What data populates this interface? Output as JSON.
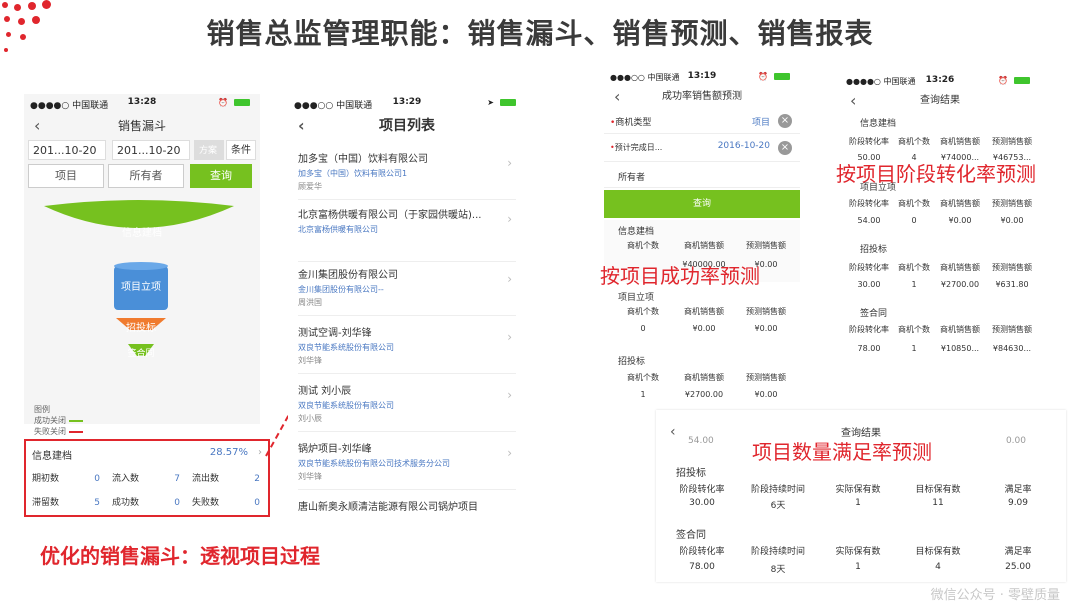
{
  "slide": {
    "title": "销售总监管理职能：销售漏斗、销售预测、销售报表",
    "caption": "优化的销售漏斗：透视项目过程",
    "watermark": "微信公众号 · 零壁质量",
    "colors": {
      "accent": "#e0262d",
      "green": "#76c11f",
      "blue": "#4a78c2"
    }
  },
  "phone1": {
    "status": {
      "carrier": "●●●●○ 中国联通",
      "time": "13:28"
    },
    "nav_title": "销售漏斗",
    "date_from": "201...10-20",
    "date_to": "201...10-20",
    "toggle_a": "方案",
    "toggle_b": "条件",
    "filter_project": "项目",
    "filter_owner": "所有者",
    "query_label": "查询",
    "funnel": [
      "信息建档",
      "项目立项",
      "招投标",
      "签合同"
    ],
    "legend_title": "图例",
    "legend_success": "成功关闭",
    "legend_fail": "失败关闭",
    "stats": {
      "stage": "信息建档",
      "rate": "28.57%",
      "cells": [
        {
          "label": "期初数",
          "value": "0"
        },
        {
          "label": "流入数",
          "value": "7"
        },
        {
          "label": "流出数",
          "value": "2"
        },
        {
          "label": "滞留数",
          "value": "5"
        },
        {
          "label": "成功数",
          "value": "0"
        },
        {
          "label": "失败数",
          "value": "0"
        }
      ]
    }
  },
  "phone2": {
    "status": {
      "carrier": "●●●○○ 中国联通",
      "time": "13:29"
    },
    "nav_title": "项目列表",
    "items": [
      {
        "name": "加多宝（中国）饮料有限公司",
        "company": "加多宝（中国）饮料有限公司1",
        "owner": "顾爱华"
      },
      {
        "name": "北京富杨供暖有限公司（于家园供暖站)...",
        "company": "北京富杨供暖有限公司",
        "owner": ""
      },
      {
        "name": "金川集团股份有限公司",
        "company": "金川集团股份有限公司--",
        "owner": "周洪国"
      },
      {
        "name": "测试空调-刘华锋",
        "company": "双良节能系统股份有限公司",
        "owner": "刘华锋"
      },
      {
        "name": "测试 刘小辰",
        "company": "双良节能系统股份有限公司",
        "owner": "刘小辰"
      },
      {
        "name": "锅炉项目-刘华峰",
        "company": "双良节能系统股份有限公司技术服务分公司",
        "owner": "刘华锋"
      },
      {
        "name": "唐山新奥永顺清洁能源有限公司锅炉项目",
        "company": "",
        "owner": ""
      }
    ]
  },
  "phone3": {
    "status": {
      "carrier": "●●●○○ 中国联通",
      "time": "13:19"
    },
    "nav_title": "成功率销售额预测",
    "field1_label": "商机类型",
    "field1_value": "项目",
    "field2_label": "预计完成日...",
    "field2_value": "2016-10-20",
    "owner_label": "所有者",
    "query_label": "查询",
    "headers": [
      "商机个数",
      "商机销售额",
      "预测销售额"
    ],
    "sections": [
      {
        "name": "信息建档",
        "values": [
          "",
          "¥40000.00",
          "¥0.00"
        ]
      },
      {
        "name": "项目立项",
        "values": [
          "0",
          "¥0.00",
          "¥0.00"
        ]
      },
      {
        "name": "招投标",
        "values": [
          "1",
          "¥2700.00",
          "¥0.00"
        ]
      }
    ]
  },
  "phone4": {
    "status": {
      "carrier": "●●●●○ 中国联通",
      "time": "13:26"
    },
    "nav_title": "查询结果",
    "headers": [
      "阶段转化率",
      "商机个数",
      "商机销售额",
      "预测销售额"
    ],
    "sections": [
      {
        "name": "信息建档",
        "values": [
          "50.00",
          "4",
          "¥74000...",
          "¥46753..."
        ]
      },
      {
        "name": "项目立项",
        "values": [
          "54.00",
          "0",
          "¥0.00",
          "¥0.00"
        ]
      },
      {
        "name": "招投标",
        "values": [
          "30.00",
          "1",
          "¥2700.00",
          "¥631.80"
        ]
      },
      {
        "name": "签合同",
        "values": [
          "78.00",
          "1",
          "¥10850...",
          "¥84630..."
        ]
      }
    ]
  },
  "overlay": {
    "nav_title": "查询结果",
    "partial_left": "54.00",
    "partial_right": "0.00",
    "headers": [
      "阶段转化率",
      "阶段持续时间",
      "实际保有数",
      "目标保有数",
      "满足率"
    ],
    "sections": [
      {
        "name": "招投标",
        "values": [
          "30.00",
          "6天",
          "1",
          "11",
          "9.09"
        ]
      },
      {
        "name": "签合同",
        "values": [
          "78.00",
          "8天",
          "1",
          "4",
          "25.00"
        ]
      }
    ]
  },
  "annotations": {
    "success_forecast": "按项目成功率预测",
    "stage_forecast": "按项目阶段转化率预测",
    "quantity_forecast": "项目数量满足率预测"
  }
}
